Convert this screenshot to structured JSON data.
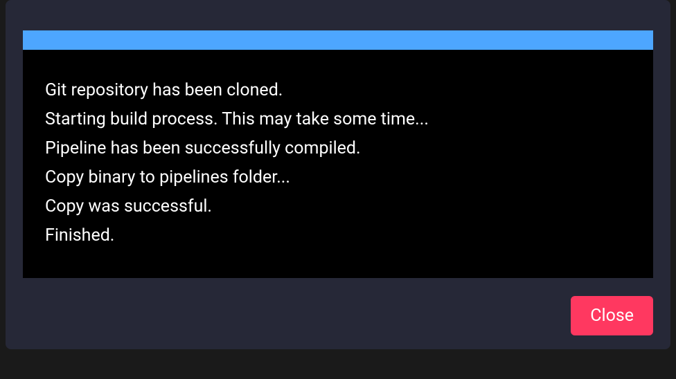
{
  "console": {
    "lines": [
      "Git repository has been cloned.",
      "Starting build process. This may take some time...",
      "Pipeline has been successfully compiled.",
      "Copy binary to pipelines folder...",
      "Copy was successful.",
      "Finished."
    ]
  },
  "footer": {
    "close_label": "Close"
  },
  "colors": {
    "modal_bg": "#262837",
    "console_bg": "#000000",
    "header_bar": "#4da6ff",
    "close_button": "#ff3860"
  }
}
